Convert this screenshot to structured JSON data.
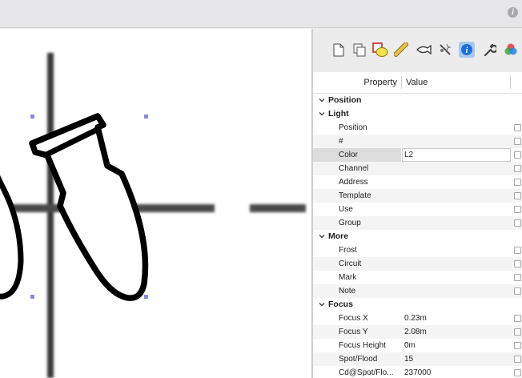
{
  "topbar": {
    "info_icon": "info-icon"
  },
  "toolbar": {
    "icons": [
      "new-document-icon",
      "duplicate-icon",
      "shapes-icon",
      "ruler-icon",
      "fish-icon",
      "magic-wand-icon",
      "info-icon",
      "wrench-icon",
      "color-wheel-icon"
    ],
    "active_index": 6,
    "accent": "#a8c8f0"
  },
  "table": {
    "header_property": "Property",
    "header_value": "Value",
    "rows": [
      {
        "type": "group",
        "label": "Position"
      },
      {
        "type": "group",
        "label": "Light"
      },
      {
        "type": "prop",
        "label": "Position",
        "value": ""
      },
      {
        "type": "prop",
        "label": "#",
        "value": ""
      },
      {
        "type": "prop",
        "label": "Color",
        "value": "L2",
        "selected": true
      },
      {
        "type": "prop",
        "label": "Channel",
        "value": ""
      },
      {
        "type": "prop",
        "label": "Address",
        "value": ""
      },
      {
        "type": "prop",
        "label": "Template",
        "value": ""
      },
      {
        "type": "prop",
        "label": "Use",
        "value": ""
      },
      {
        "type": "prop",
        "label": "Group",
        "value": ""
      },
      {
        "type": "group",
        "label": "More"
      },
      {
        "type": "prop",
        "label": "Frost",
        "value": ""
      },
      {
        "type": "prop",
        "label": "Circuit",
        "value": ""
      },
      {
        "type": "prop",
        "label": "Mark",
        "value": ""
      },
      {
        "type": "prop",
        "label": "Note",
        "value": ""
      },
      {
        "type": "group",
        "label": "Focus"
      },
      {
        "type": "prop",
        "label": "Focus X",
        "value": "0.23m"
      },
      {
        "type": "prop",
        "label": "Focus Y",
        "value": "2.08m"
      },
      {
        "type": "prop",
        "label": "Focus Height",
        "value": "0m"
      },
      {
        "type": "prop",
        "label": "Spot/Flood",
        "value": "15"
      },
      {
        "type": "prop",
        "label": "Cd@Spot/Flo...",
        "value": "237000"
      }
    ]
  },
  "colors": {
    "selection_handle": "#8a8ae0"
  }
}
